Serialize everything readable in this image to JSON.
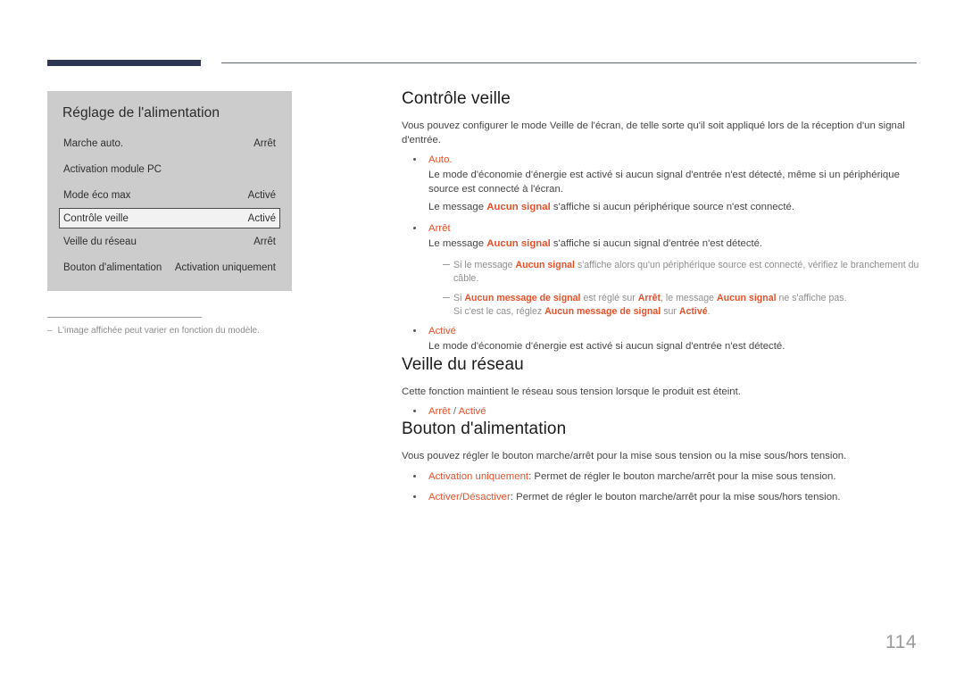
{
  "header": {
    "rule_color": "#2e3454",
    "thin_rule_color": "#5b5f79"
  },
  "osd_panel": {
    "title": "Réglage de l'alimentation",
    "rows": [
      {
        "label": "Marche auto.",
        "value": "Arrêt",
        "selected": false
      },
      {
        "label": "Activation module PC",
        "value": "",
        "selected": false
      },
      {
        "label": "Mode éco max",
        "value": "Activé",
        "selected": false
      },
      {
        "label": "Contrôle veille",
        "value": "Activé",
        "selected": true
      },
      {
        "label": "Veille du réseau",
        "value": "Arrêt",
        "selected": false
      },
      {
        "label": "Bouton d'alimentation",
        "value": "Activation uniquement",
        "selected": false
      }
    ]
  },
  "figure_note": {
    "dash": "–",
    "text": "L'image affichée peut varier en fonction du modèle."
  },
  "sections": {
    "controle_veille": {
      "heading": "Contrôle veille",
      "intro": "Vous pouvez configurer le mode Veille de l'écran, de telle sorte qu'il soit appliqué lors de la réception d'un signal d'entrée.",
      "bullet_auto": {
        "head": "Auto.",
        "line1": "Le mode d'économie d'énergie est activé si aucun signal d'entrée n'est détecté, même si un périphérique source est connecté à l'écran.",
        "line2_pre": "Le message ",
        "line2_hl": "Aucun signal",
        "line2_post": " s'affiche si aucun périphérique source n'est connecté."
      },
      "bullet_arret": {
        "head": "Arrêt",
        "line1_pre": "Le message ",
        "line1_hl": "Aucun signal",
        "line1_post": " s'affiche si aucun signal d'entrée n'est détecté."
      },
      "subnote_1": {
        "pre": "Si le message ",
        "hl": "Aucun signal",
        "post": " s'affiche alors qu'un périphérique source est connecté, vérifiez le branchement du câble."
      },
      "subnote_2": {
        "l1_pre": "Si ",
        "l1_hl1": "Aucun message de signal",
        "l1_mid1": " est réglé sur ",
        "l1_hl2": "Arrêt",
        "l1_mid2": ", le message ",
        "l1_hl3": "Aucun signal",
        "l1_post": " ne s'affiche pas.",
        "l2_pre": "Si c'est le cas, réglez ",
        "l2_hl1": "Aucun message de signal",
        "l2_mid": " sur ",
        "l2_hl2": "Activé",
        "l2_post": "."
      },
      "bullet_active": {
        "head": "Activé",
        "line1": "Le mode d'économie d'énergie est activé si aucun signal d'entrée n'est détecté."
      }
    },
    "veille_reseau": {
      "heading": "Veille du réseau",
      "intro": "Cette fonction maintient le réseau sous tension lorsque le produit est éteint.",
      "option_a": "Arrêt",
      "option_sep": " / ",
      "option_b": "Activé"
    },
    "bouton_alimentation": {
      "heading": "Bouton d'alimentation",
      "intro": "Vous pouvez régler le bouton marche/arrêt pour la mise sous tension ou la mise sous/hors tension.",
      "bullet_1_term": "Activation uniquement",
      "bullet_1_desc": ": Permet de régler le bouton marche/arrêt pour la mise sous tension.",
      "bullet_2_term": "Activer/Désactiver",
      "bullet_2_desc": ": Permet de régler le bouton marche/arrêt pour la mise sous/hors tension."
    }
  },
  "page_number": "114",
  "colors": {
    "accent": "#e8512a",
    "header_bar": "#2e3454",
    "panel_bg": "#cccccc",
    "body_text": "#464646"
  }
}
